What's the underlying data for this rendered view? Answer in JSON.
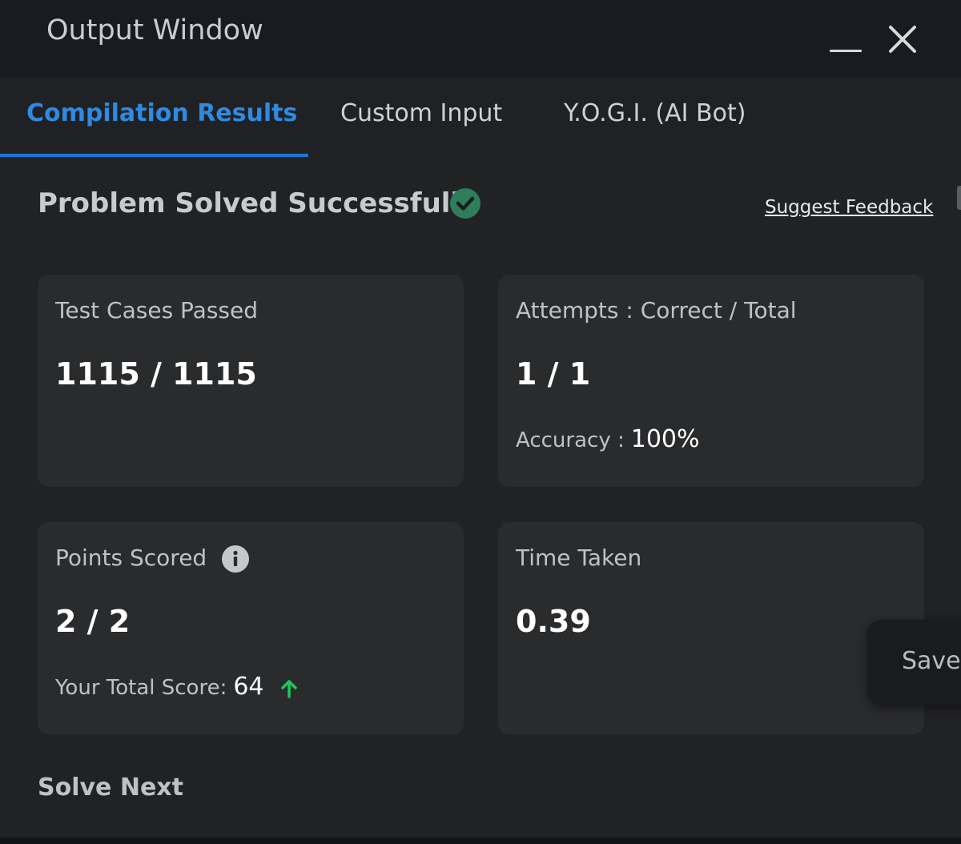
{
  "window": {
    "title": "Output Window"
  },
  "tabs": [
    {
      "label": "Compilation Results",
      "active": true
    },
    {
      "label": "Custom Input",
      "active": false
    },
    {
      "label": "Y.O.G.I. (AI Bot)",
      "active": false
    }
  ],
  "status": {
    "title": "Problem Solved Successfully",
    "icon": "check-circle-icon",
    "icon_color": "#2e7d5b"
  },
  "feedback_link": "Suggest Feedback",
  "cards": {
    "test_cases": {
      "label": "Test Cases Passed",
      "value": "1115 / 1115"
    },
    "attempts": {
      "label": "Attempts : Correct / Total",
      "value": "1 / 1",
      "sub_label": "Accuracy :",
      "sub_value": "100%"
    },
    "points": {
      "label": "Points Scored",
      "value": "2 / 2",
      "sub_label": "Your Total Score:",
      "sub_value": "64",
      "trend_icon": "arrow-up-icon",
      "trend_color": "#22c55e"
    },
    "time": {
      "label": "Time Taken",
      "value": "0.39"
    }
  },
  "solve_next": "Solve Next",
  "toast": {
    "text": "Saved"
  },
  "colors": {
    "accent": "#1976d2",
    "background": "#212224",
    "card": "#2a2b2d"
  }
}
